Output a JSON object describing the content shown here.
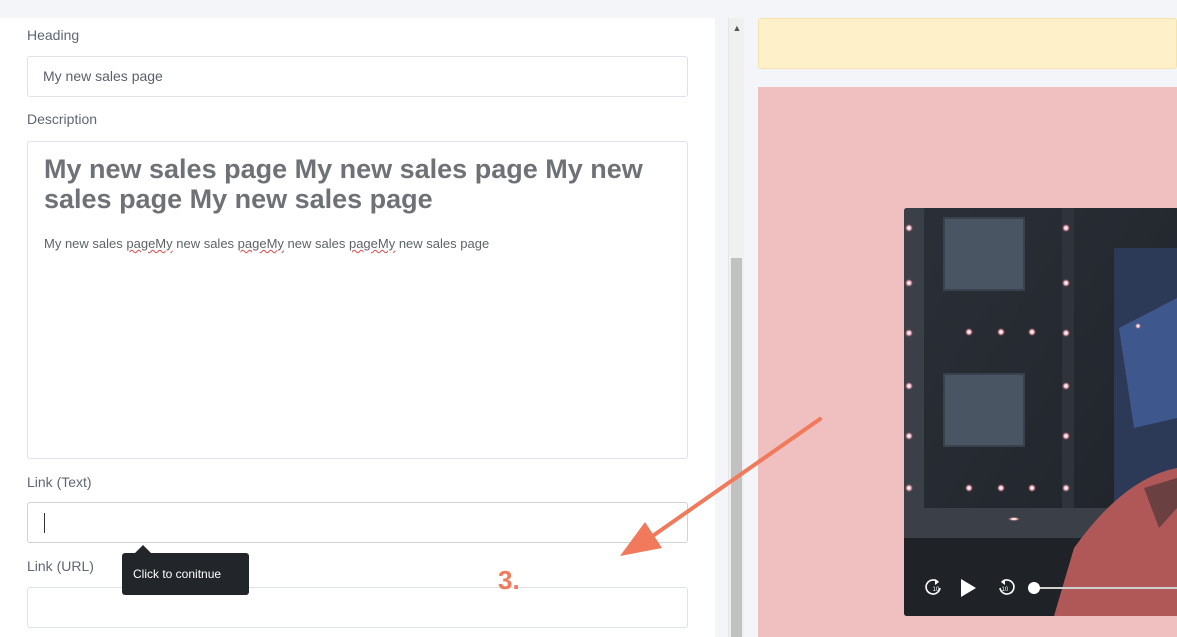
{
  "editor": {
    "heading_label": "Heading",
    "heading_value": "My new sales page",
    "description_label": "Description",
    "description": {
      "heading": "My new sales page My new sales page My new sales page My new sales page",
      "body_parts": [
        "My new sales ",
        "pageMy",
        " new sales ",
        "pageMy",
        " new sales ",
        "pageMy",
        " new sales page"
      ]
    },
    "link_text_label": "Link (Text)",
    "link_text_value": "",
    "link_url_label": "Link (URL)",
    "link_url_value": ""
  },
  "tooltip": {
    "text": "Click to conitnue"
  },
  "annotation": {
    "step": "3.",
    "color": "#f07a5b"
  },
  "preview": {
    "notice_color": "#fef0c8",
    "section_color": "#f0bfbf",
    "video": {
      "controls": [
        "replay-10-icon",
        "play-icon",
        "forward-10-icon",
        "progress-slider"
      ],
      "progress": 0
    }
  }
}
